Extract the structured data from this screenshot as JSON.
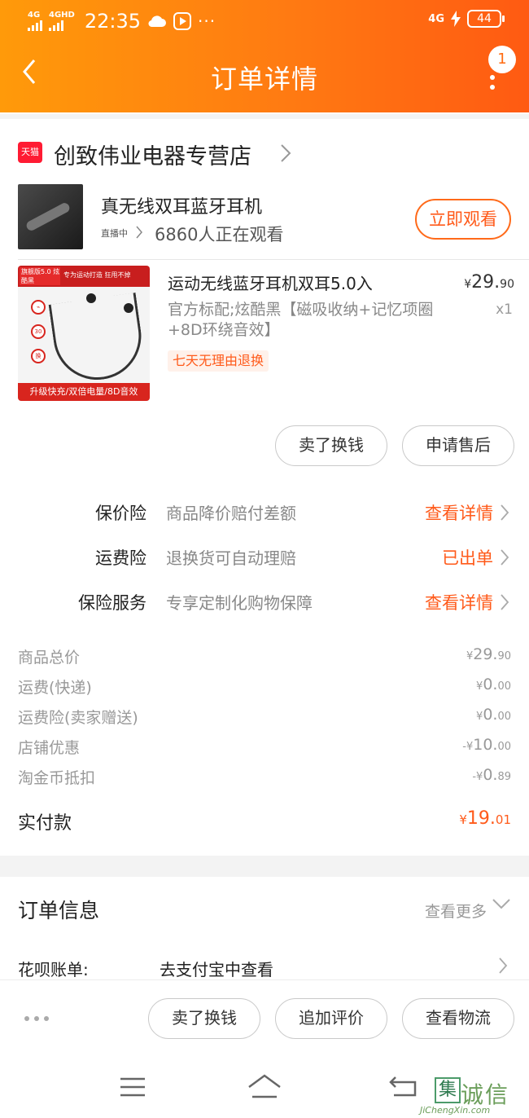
{
  "status_bar": {
    "network1": "4G",
    "network2": "4GHD",
    "time": "22:35",
    "network3": "4G",
    "battery": "44"
  },
  "nav": {
    "title": "订单详情",
    "badge_count": "1"
  },
  "store": {
    "platform_badge": "天猫",
    "name": "创致伟业电器专营店"
  },
  "live": {
    "title": "真无线双耳蓝牙耳机",
    "tag": "直播中",
    "viewers": "6860人正在观看",
    "watch_button": "立即观看"
  },
  "product": {
    "image_top_left": "旗舰版5.0 炫酷黑",
    "image_top_right": "专为运动打造 狂甩不掉",
    "image_bottom": "升级快充/双倍电量/8D音效",
    "title": "运动无线蓝牙耳机双耳5.0入",
    "price_symbol": "¥",
    "price_int": "29.",
    "price_dec": "90",
    "sku": "官方标配;炫酷黑【磁吸收纳+记忆项圈+8D环绕音效】",
    "quantity": "x1",
    "return_tag": "七天无理由退换",
    "sell_button": "卖了换钱",
    "after_sale_button": "申请售后"
  },
  "insurance": [
    {
      "label": "保价险",
      "desc": "商品降价赔付差额",
      "action": "查看详情"
    },
    {
      "label": "运费险",
      "desc": "退换货可自动理赔",
      "action": "已出单"
    },
    {
      "label": "保险服务",
      "desc": "专享定制化购物保障",
      "action": "查看详情"
    }
  ],
  "price_lines": [
    {
      "label": "商品总价",
      "prefix": "¥",
      "int": "29.",
      "dec": "90"
    },
    {
      "label": "运费(快递)",
      "prefix": "¥",
      "int": "0.",
      "dec": "00"
    },
    {
      "label": "运费险(卖家赠送)",
      "prefix": "¥",
      "int": "0.",
      "dec": "00"
    },
    {
      "label": "店铺优惠",
      "prefix": "-¥",
      "int": "10.",
      "dec": "00"
    },
    {
      "label": "淘金币抵扣",
      "prefix": "-¥",
      "int": "0.",
      "dec": "89"
    }
  ],
  "total": {
    "label": "实付款",
    "prefix": "¥",
    "int": "19.",
    "dec": "01"
  },
  "order_info": {
    "title": "订单信息",
    "more": "查看更多",
    "huabei_label": "花呗账单:",
    "huabei_value": "去支付宝中查看"
  },
  "bottom_actions": {
    "sell": "卖了换钱",
    "review": "追加评价",
    "logistics": "查看物流"
  },
  "watermark": {
    "char": "集",
    "text": "诚信",
    "sub": "JiChengXin.com"
  },
  "colors": {
    "header_start": "#ff9a0a",
    "header_end": "#ff5a12",
    "accent": "#ff5a1a",
    "tmall_red": "#ff1b33"
  }
}
